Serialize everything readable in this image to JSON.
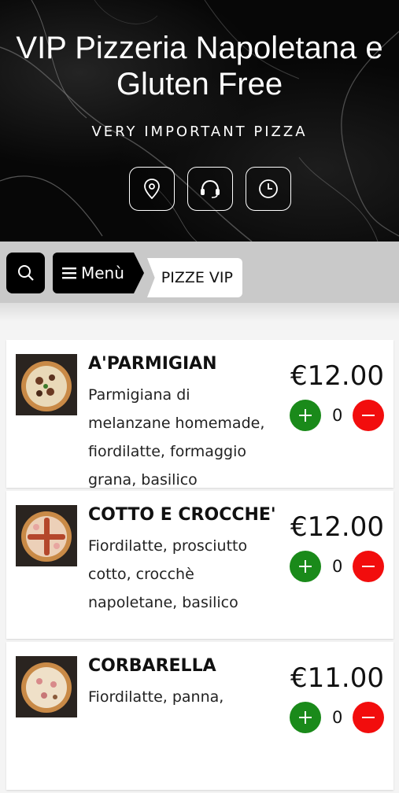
{
  "header": {
    "title": "VIP Pizzeria Napoletana e Gluten Free",
    "subtitle": "VERY IMPORTANT PIZZA",
    "buttons": [
      {
        "icon": "location-pin-icon"
      },
      {
        "icon": "headset-icon"
      },
      {
        "icon": "clock-icon"
      }
    ]
  },
  "nav": {
    "search_icon": "search-icon",
    "menu_label": "Menù",
    "menu_icon": "hamburger-icon",
    "breadcrumb": "PIZZE VIP"
  },
  "items": [
    {
      "name": "A'PARMIGIAN",
      "description": "Parmigiana di melanzane homemade, fiordilatte, formaggio grana, basilico",
      "price": "€12.00",
      "quantity": "0"
    },
    {
      "name": "COTTO E CROCCHE'",
      "description": "Fiordilatte, prosciutto cotto, crocchè napoletane, basilico",
      "price": "€12.00",
      "quantity": "0"
    },
    {
      "name": "CORBARELLA",
      "description": "Fiordilatte, panna,",
      "price": "€11.00",
      "quantity": "0"
    }
  ],
  "colors": {
    "plus": "#1a8a1a",
    "minus": "#f20d0d",
    "nav_bg": "#c9c9c9"
  }
}
